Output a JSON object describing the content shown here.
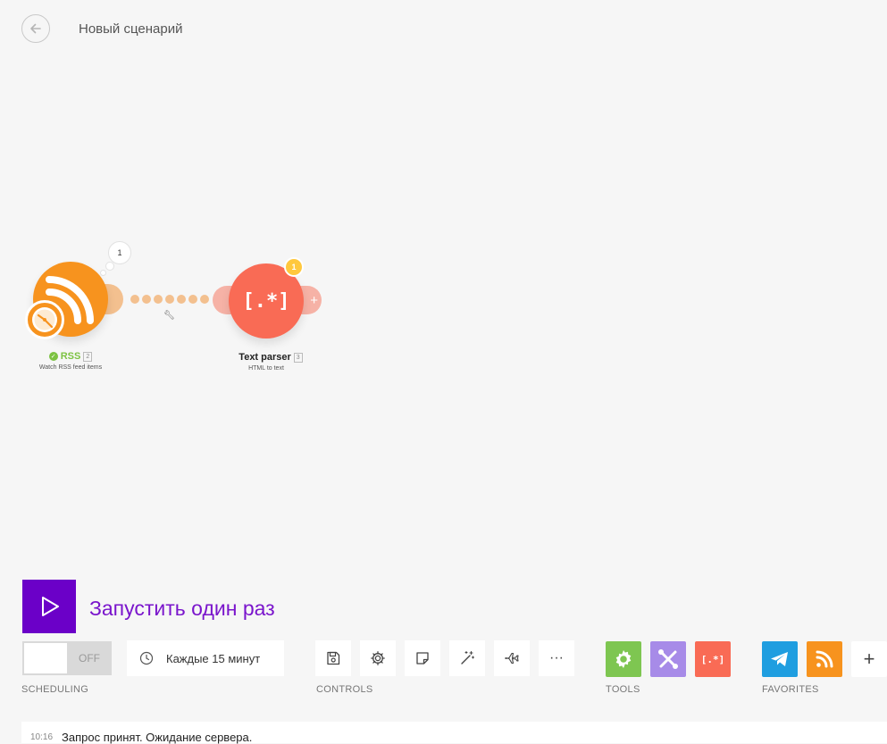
{
  "header": {
    "title": "Новый сценарий"
  },
  "nodes": {
    "rss": {
      "name": "RSS",
      "id": "2",
      "subtitle": "Watch RSS feed items",
      "bubble": "1"
    },
    "text_parser": {
      "name": "Text parser",
      "id": "3",
      "subtitle": "HTML to text",
      "badge": "1",
      "glyph": "[.*]"
    }
  },
  "run": {
    "label": "Запустить один раз"
  },
  "scheduling": {
    "toggle": "OFF",
    "interval": "Каждые 15 минут",
    "section": "SCHEDULING"
  },
  "controls": {
    "section": "CONTROLS",
    "more": "···"
  },
  "tools": {
    "section": "TOOLS",
    "parser_glyph": "[.*]"
  },
  "favorites": {
    "section": "FAVORITES",
    "add": "+"
  },
  "log": {
    "time": "10:16",
    "message": "Запрос принят. Ожидание сервера."
  },
  "colors": {
    "accent": "#6b00c8",
    "rss": "#f7931e",
    "text_parser": "#f96b55",
    "tools_green": "#7ec651",
    "tools_purple": "#a78be8",
    "telegram": "#1f9ee0"
  }
}
